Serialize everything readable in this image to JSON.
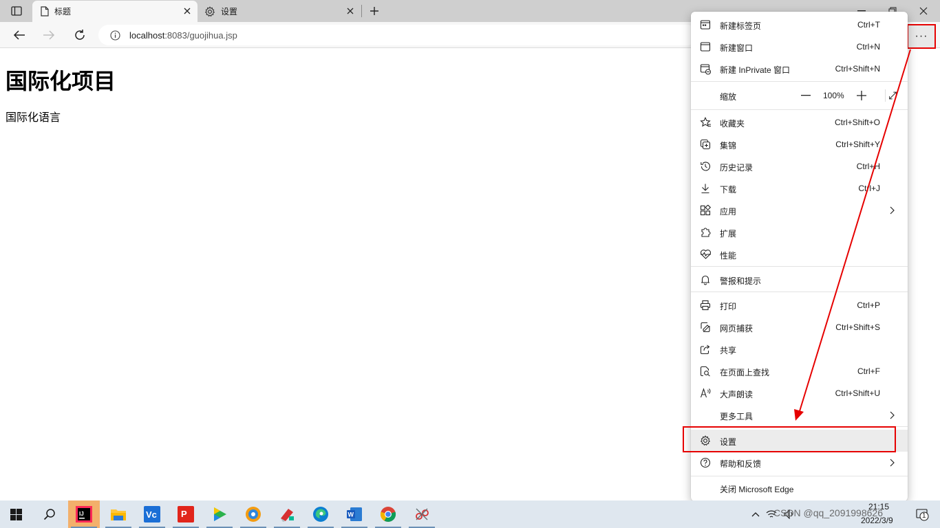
{
  "browser": {
    "tabs": [
      {
        "title": "标题",
        "active": true
      },
      {
        "title": "设置",
        "active": false
      }
    ],
    "url_host": "localhost",
    "url_path": ":8083/guojihua.jsp",
    "more_label": "···"
  },
  "page": {
    "heading": "国际化项目",
    "paragraph": "国际化语言"
  },
  "menu": {
    "items": [
      {
        "label": "新建标签页",
        "shortcut": "Ctrl+T"
      },
      {
        "label": "新建窗口",
        "shortcut": "Ctrl+N"
      },
      {
        "label": "新建 InPrivate 窗口",
        "shortcut": "Ctrl+Shift+N"
      },
      {
        "label": "缩放",
        "shortcut": ""
      },
      {
        "label": "收藏夹",
        "shortcut": "Ctrl+Shift+O"
      },
      {
        "label": "集锦",
        "shortcut": "Ctrl+Shift+Y"
      },
      {
        "label": "历史记录",
        "shortcut": "Ctrl+H"
      },
      {
        "label": "下载",
        "shortcut": "Ctrl+J"
      },
      {
        "label": "应用",
        "shortcut": ""
      },
      {
        "label": "扩展",
        "shortcut": ""
      },
      {
        "label": "性能",
        "shortcut": ""
      },
      {
        "label": "警报和提示",
        "shortcut": ""
      },
      {
        "label": "打印",
        "shortcut": "Ctrl+P"
      },
      {
        "label": "网页捕获",
        "shortcut": "Ctrl+Shift+S"
      },
      {
        "label": "共享",
        "shortcut": ""
      },
      {
        "label": "在页面上查找",
        "shortcut": "Ctrl+F"
      },
      {
        "label": "大声朗读",
        "shortcut": "Ctrl+Shift+U"
      },
      {
        "label": "更多工具",
        "shortcut": ""
      },
      {
        "label": "设置",
        "shortcut": ""
      },
      {
        "label": "帮助和反馈",
        "shortcut": ""
      },
      {
        "label": "关闭 Microsoft Edge",
        "shortcut": ""
      }
    ],
    "zoom": {
      "value": "100%",
      "minus": "—",
      "plus": "+"
    }
  },
  "taskbar": {
    "time": "21:15",
    "date": "2022/3/9",
    "watermark": "CSDN @qq_2091998626",
    "notification_count": "1"
  },
  "colors": {
    "annotation_red": "#e60000",
    "tabstrip": "#cfcfcf",
    "taskbar": "#dfe7ef"
  }
}
